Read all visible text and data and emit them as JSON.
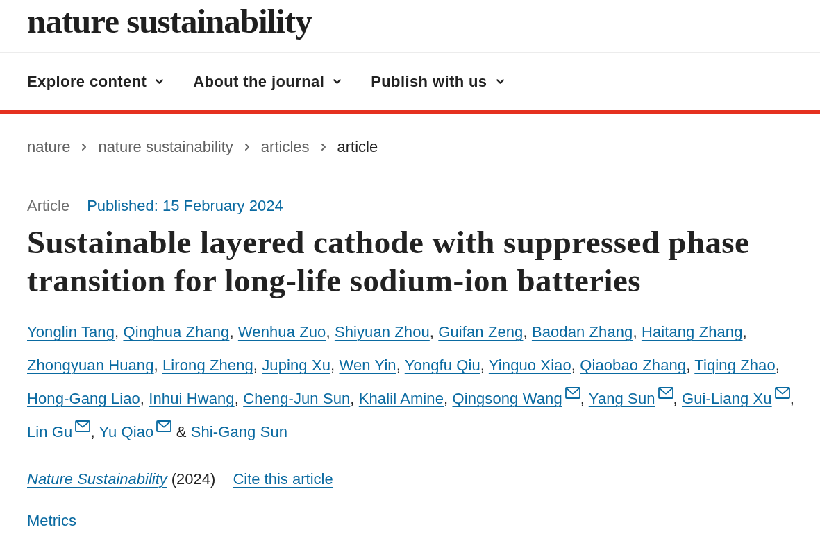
{
  "header": {
    "logo": "nature sustainability"
  },
  "nav": {
    "items": [
      {
        "label": "Explore content",
        "expanded": false
      },
      {
        "label": "About the journal",
        "expanded": false
      },
      {
        "label": "Publish with us",
        "expanded": false
      }
    ]
  },
  "breadcrumbs": [
    {
      "label": "nature",
      "kind": "link"
    },
    {
      "label": "nature sustainability",
      "kind": "link"
    },
    {
      "label": "articles",
      "kind": "link"
    },
    {
      "label": "article",
      "kind": "current"
    }
  ],
  "article": {
    "type": "Article",
    "published": "Published: 15 February 2024",
    "title": "Sustainable layered cathode with suppressed phase transition for long-life sodium-ion batteries",
    "authors": [
      {
        "name": "Yonglin Tang",
        "email": false,
        "separator": ", "
      },
      {
        "name": "Qinghua Zhang",
        "email": false,
        "separator": ", "
      },
      {
        "name": "Wenhua Zuo",
        "email": false,
        "separator": ", "
      },
      {
        "name": "Shiyuan Zhou",
        "email": false,
        "separator": ", "
      },
      {
        "name": "Guifan Zeng",
        "email": false,
        "separator": ", "
      },
      {
        "name": "Baodan Zhang",
        "email": false,
        "separator": ", "
      },
      {
        "name": "Haitang Zhang",
        "email": false,
        "separator": ", "
      },
      {
        "name": "Zhongyuan Huang",
        "email": false,
        "separator": ", "
      },
      {
        "name": "Lirong Zheng",
        "email": false,
        "separator": ", "
      },
      {
        "name": "Juping Xu",
        "email": false,
        "separator": ", "
      },
      {
        "name": "Wen Yin",
        "email": false,
        "separator": ", "
      },
      {
        "name": "Yongfu Qiu",
        "email": false,
        "separator": ", "
      },
      {
        "name": "Yinguo Xiao",
        "email": false,
        "separator": ", "
      },
      {
        "name": "Qiaobao Zhang",
        "email": false,
        "separator": ", "
      },
      {
        "name": "Tiqing Zhao",
        "email": false,
        "separator": ", "
      },
      {
        "name": "Hong-Gang Liao",
        "email": false,
        "separator": ", "
      },
      {
        "name": "Inhui Hwang",
        "email": false,
        "separator": ", "
      },
      {
        "name": "Cheng-Jun Sun",
        "email": false,
        "separator": ", "
      },
      {
        "name": "Khalil Amine",
        "email": false,
        "separator": ", "
      },
      {
        "name": "Qingsong Wang",
        "email": true,
        "separator": ", "
      },
      {
        "name": "Yang Sun",
        "email": true,
        "separator": ", "
      },
      {
        "name": "Gui-Liang Xu",
        "email": true,
        "separator": ", "
      },
      {
        "name": "Lin Gu",
        "email": true,
        "separator": ", "
      },
      {
        "name": "Yu Qiao",
        "email": true,
        "separator": " & "
      },
      {
        "name": "Shi-Gang Sun",
        "email": false
      }
    ],
    "journal": "Nature Sustainability",
    "year": "(2024)",
    "cite": "Cite this article",
    "metrics": "Metrics"
  }
}
